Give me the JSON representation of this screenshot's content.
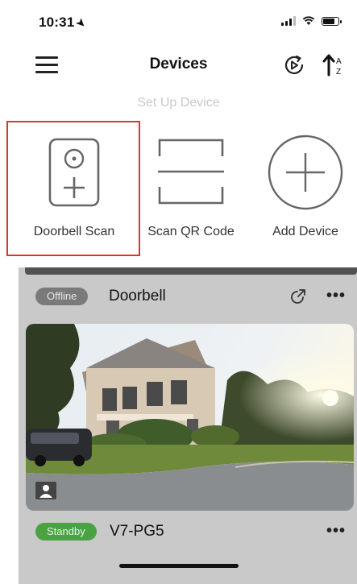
{
  "status_bar": {
    "time": "10:31",
    "battery_level": 0.85
  },
  "nav": {
    "title": "Devices"
  },
  "setup": {
    "section_label": "Set Up Device",
    "actions": [
      {
        "label": "Doorbell Scan",
        "icon": "doorbell-icon"
      },
      {
        "label": "Scan QR Code",
        "icon": "qr-scan-frame-icon"
      },
      {
        "label": "Add Device",
        "icon": "plus-circle-icon"
      }
    ]
  },
  "devices": [
    {
      "status": "Offline",
      "name": "Doorbell"
    },
    {
      "status": "Standby",
      "name": "V7-PG5"
    }
  ],
  "colors": {
    "highlight": "#d9372d",
    "offline_badge": "#7a7a7a",
    "standby_badge": "#4aa343"
  }
}
